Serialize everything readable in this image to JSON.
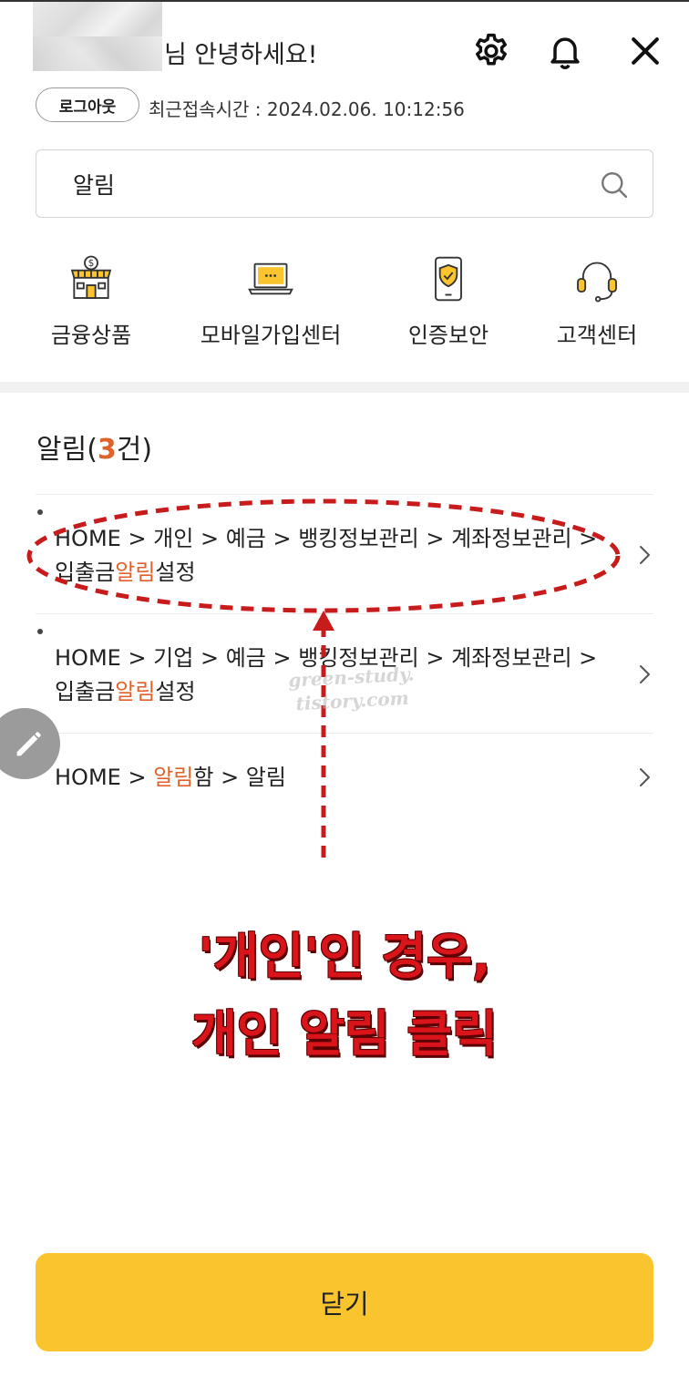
{
  "header": {
    "greeting": "님 안녕하세요!",
    "logout_label": "로그아웃",
    "last_access": "최근접속시간 : 2024.02.06. 10:12:56"
  },
  "search": {
    "value": "알림"
  },
  "quick_menu": [
    {
      "label": "금융상품",
      "icon": "store-icon"
    },
    {
      "label": "모바일가입센터",
      "icon": "laptop-icon"
    },
    {
      "label": "인증보안",
      "icon": "shield-phone-icon"
    },
    {
      "label": "고객센터",
      "icon": "headset-icon"
    }
  ],
  "results": {
    "title_prefix": "알림(",
    "count": "3",
    "title_suffix": "건)",
    "items": [
      {
        "seg1": "HOME > 개인 > 예금 > 뱅킹정보관리 > 계좌정보관리 >",
        "seg2": "입출금",
        "hl": "알림",
        "seg3": "설정"
      },
      {
        "seg1": "HOME > 기업 > 예금 > 뱅킹정보관리 > 계좌정보관리 >",
        "seg2": "입출금",
        "hl": "알림",
        "seg3": "설정"
      },
      {
        "seg1": "HOME > ",
        "hl": "알림",
        "seg3": "함 > 알림"
      }
    ]
  },
  "annotation": {
    "line1": "'개인'인 경우,",
    "line2": "개인 알림 클릭"
  },
  "watermark": {
    "line1": "green-study.",
    "line2": "tistory.com"
  },
  "footer": {
    "close_label": "닫기"
  },
  "colors": {
    "accent": "#f9c42d",
    "highlight": "#e0622a",
    "annotation": "#d9141b"
  }
}
